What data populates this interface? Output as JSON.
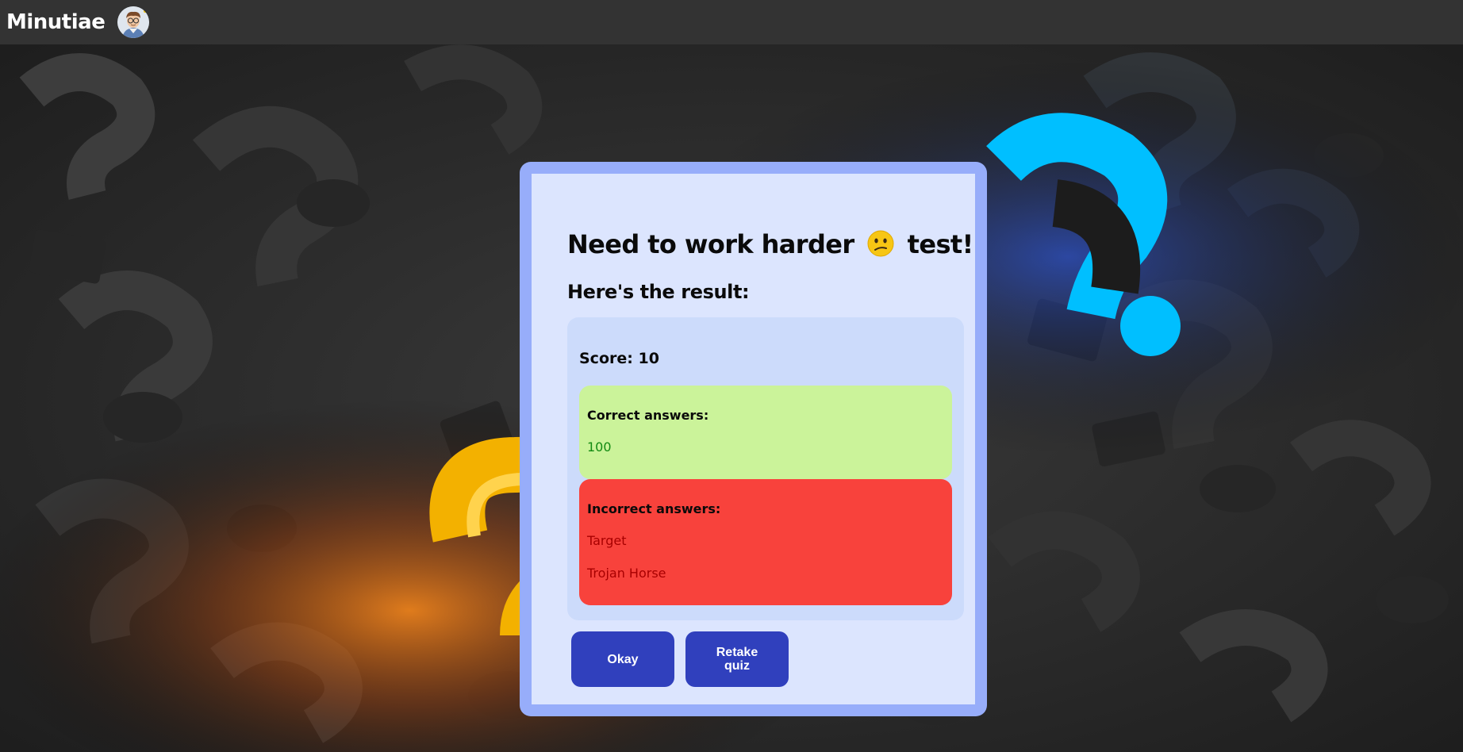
{
  "header": {
    "brand": "Minutiae",
    "avatar_icon": "user-avatar-icon"
  },
  "result": {
    "title_prefix": "Need to work harder",
    "title_emoji": "confused-face-icon",
    "title_suffix": "test!",
    "subtitle": "Here's the result:",
    "score": "Score: 10",
    "correct": {
      "label": "Correct answers:",
      "items": [
        "100"
      ]
    },
    "incorrect": {
      "label": "Incorrect answers:",
      "items": [
        "Target",
        "Trojan Horse"
      ]
    },
    "buttons": {
      "okay": "Okay",
      "retake": "Retake quiz"
    }
  },
  "colors": {
    "topbar": "#333333",
    "modal_frame": "#97adfa",
    "modal_body": "#dce5fe",
    "result_card": "#ccdbfb",
    "correct_bg": "#cbf39a",
    "correct_text": "#128a12",
    "incorrect_bg": "#f8423c",
    "incorrect_text": "#a80000",
    "button": "#3040bd"
  }
}
